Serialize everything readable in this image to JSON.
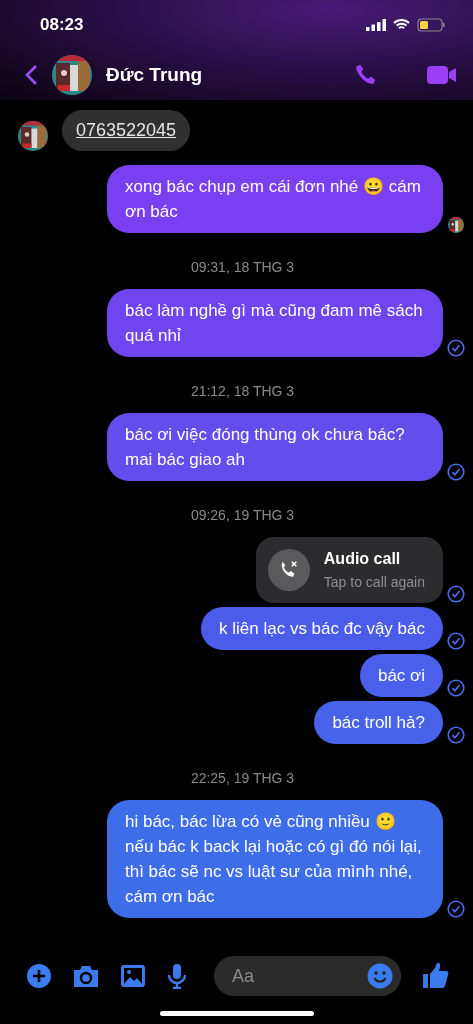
{
  "status_bar": {
    "time": "08:23"
  },
  "header": {
    "name": "Đức Trung"
  },
  "messages": [
    {
      "kind": "incoming",
      "text": "0763522045",
      "link": true
    },
    {
      "kind": "outgoing",
      "text": "xong bác chụp em cái đơn nhé 😀 cám ơn bác",
      "color": "#7b3ff2",
      "seen": true
    },
    {
      "kind": "timestamp",
      "text": "09:31, 18 THG 3"
    },
    {
      "kind": "outgoing",
      "text": "bác làm nghề gì mà cũng đam mê sách quá nhỉ",
      "color": "#6f45f0",
      "seen": false
    },
    {
      "kind": "timestamp",
      "text": "21:12, 18 THG 3"
    },
    {
      "kind": "outgoing",
      "text": "bác ơi việc đóng thùng ok chưa bác? mai bác giao ah",
      "color": "#634ded",
      "seen": false
    },
    {
      "kind": "timestamp",
      "text": "09:26, 19 THG 3"
    },
    {
      "kind": "call",
      "title": "Audio call",
      "subtitle": "Tap to call again",
      "seen": false
    },
    {
      "kind": "outgoing",
      "text": "k liên lạc vs bác đc vậy bác",
      "color": "#4b5bea",
      "seen": false
    },
    {
      "kind": "outgoing",
      "text": "bác ơi",
      "color": "#4a5fea",
      "seen": false
    },
    {
      "kind": "outgoing",
      "text": "bác troll hả?",
      "color": "#4862ea",
      "seen": false
    },
    {
      "kind": "timestamp",
      "text": "22:25, 19 THG 3"
    },
    {
      "kind": "outgoing",
      "text": "hi bác, bác lừa có vẻ cũng nhiều 🙂 nếu bác k back lại hoặc có gì đó nói lại, thì bác sẽ nc vs luật sư của mình nhé, cám ơn bác",
      "color": "#3d6de9",
      "seen": false
    }
  ],
  "composer": {
    "placeholder": "Aa"
  }
}
